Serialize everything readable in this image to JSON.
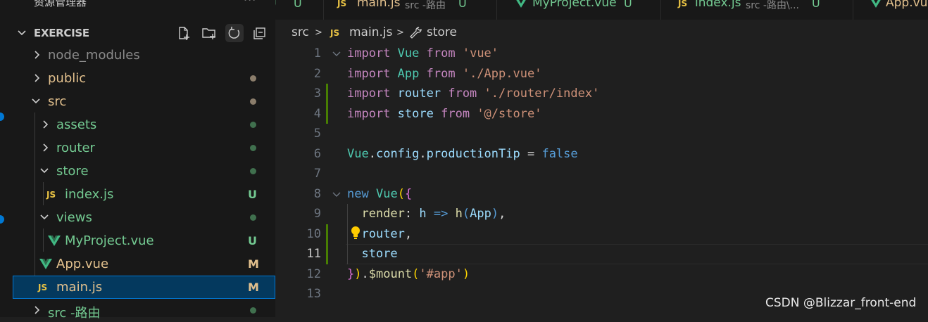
{
  "explorer": {
    "title": "资源管理器",
    "more": "···",
    "section": "EXERCISE",
    "tree": [
      {
        "label": "node_modules",
        "badge": "",
        "dot": ""
      },
      {
        "label": "public",
        "badge": "",
        "dot": "#8b7d6b"
      },
      {
        "label": "src",
        "badge": "",
        "dot": "#8b7d6b"
      },
      {
        "label": "assets",
        "badge": "",
        "dot": "#40704e"
      },
      {
        "label": "router",
        "badge": "",
        "dot": "#40704e"
      },
      {
        "label": "store",
        "badge": "",
        "dot": "#40704e"
      },
      {
        "label": "index.js",
        "badge": "U",
        "dot": ""
      },
      {
        "label": "views",
        "badge": "",
        "dot": "#40704e"
      },
      {
        "label": "MyProject.vue",
        "badge": "U",
        "dot": ""
      },
      {
        "label": "App.vue",
        "badge": "M",
        "dot": ""
      },
      {
        "label": "main.js",
        "badge": "M",
        "dot": ""
      },
      {
        "label": "src -路由",
        "badge": "",
        "dot": "#40704e"
      }
    ],
    "icons": {
      "js": "JS"
    }
  },
  "tabs": [
    {
      "label": "U",
      "sub": "",
      "status": ""
    },
    {
      "label": "main.js",
      "sub": "src -路由",
      "status": "U"
    },
    {
      "label": "MyProject.vue",
      "sub": "",
      "status": "U"
    },
    {
      "label": "index.js",
      "sub": "src -路由\\...",
      "status": "U"
    },
    {
      "label": "App.vu",
      "sub": "",
      "status": ""
    }
  ],
  "breadcrumb": {
    "folder": "src",
    "file": "main.js",
    "symbol": "store",
    "sep": ">"
  },
  "code": {
    "line_numbers": [
      "1",
      "2",
      "3",
      "4",
      "5",
      "6",
      "7",
      "8",
      "9",
      "10",
      "11",
      "12",
      "13"
    ],
    "current_line": "11"
  },
  "watermark": "CSDN @Blizzar_front-end"
}
